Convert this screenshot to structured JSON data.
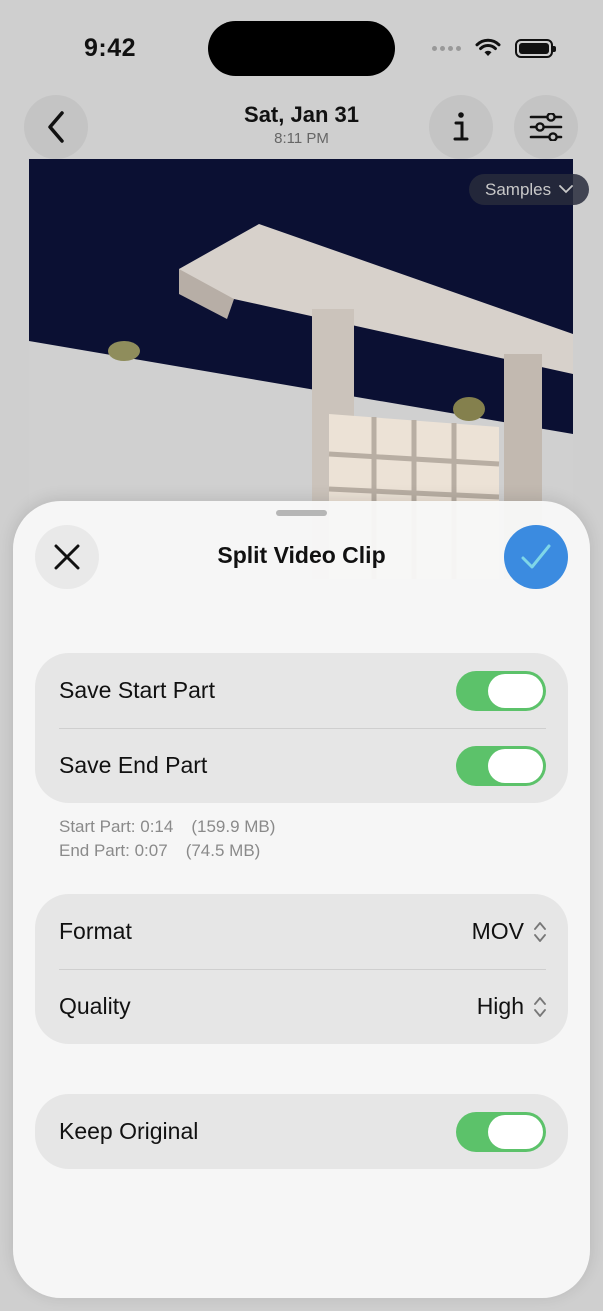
{
  "status_bar": {
    "time": "9:42"
  },
  "nav": {
    "date": "Sat, Jan 31",
    "time": "8:11 PM"
  },
  "samples_button": {
    "label": "Samples"
  },
  "sheet": {
    "title": "Split Video Clip",
    "save_start_label": "Save Start Part",
    "save_start_on": true,
    "save_end_label": "Save End Part",
    "save_end_on": true,
    "start_info": "Start Part: 0:14",
    "start_size": "(159.9 MB)",
    "end_info": "End Part: 0:07",
    "end_size": "(74.5 MB)",
    "format_label": "Format",
    "format_value": "MOV",
    "quality_label": "Quality",
    "quality_value": "High",
    "keep_original_label": "Keep Original",
    "keep_original_on": true
  },
  "colors": {
    "accent": "#3b8be0",
    "toggle_on": "#5cc26a"
  }
}
